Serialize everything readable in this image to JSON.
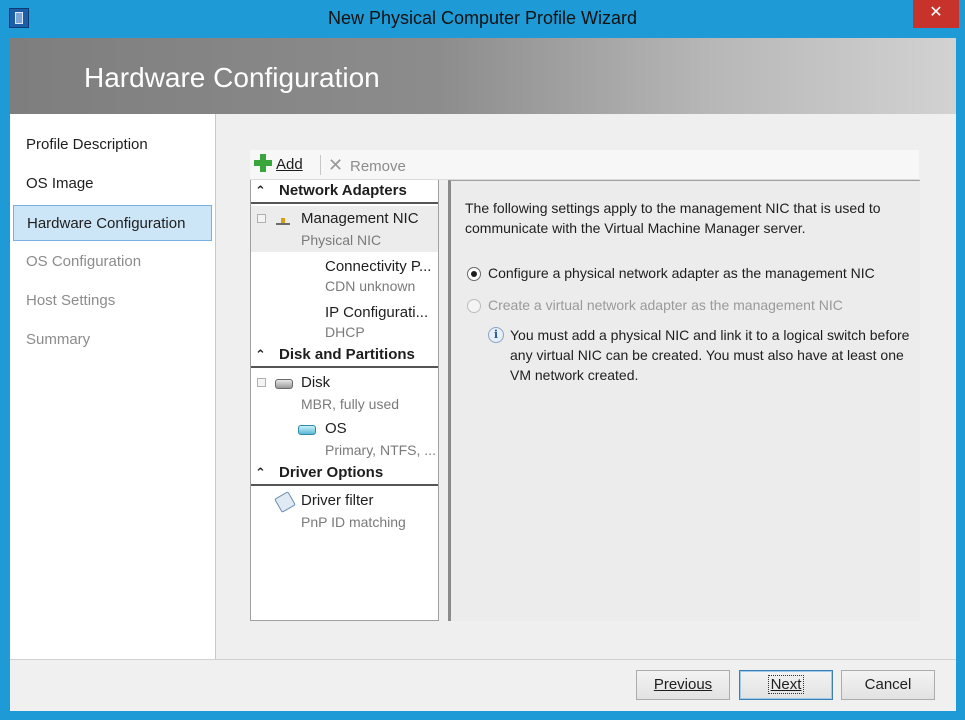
{
  "window": {
    "title": "New Physical Computer Profile Wizard",
    "close_label": "✕"
  },
  "banner": {
    "title": "Hardware Configuration"
  },
  "nav": {
    "items": [
      {
        "label": "Profile Description",
        "state": "normal"
      },
      {
        "label": "OS Image",
        "state": "normal"
      },
      {
        "label": "Hardware Configuration",
        "state": "active"
      },
      {
        "label": "OS Configuration",
        "state": "disabled"
      },
      {
        "label": "Host Settings",
        "state": "disabled"
      },
      {
        "label": "Summary",
        "state": "disabled"
      }
    ]
  },
  "toolbar": {
    "add_label": "Add",
    "remove_label": "Remove"
  },
  "tree": {
    "network_adapters": {
      "header": "Network Adapters",
      "nic": {
        "name": "Management NIC",
        "sub": "Physical NIC"
      },
      "connectivity": {
        "name": "Connectivity P...",
        "sub": "CDN unknown"
      },
      "ip": {
        "name": "IP Configurati...",
        "sub": "DHCP"
      }
    },
    "disk_partitions": {
      "header": "Disk and Partitions",
      "disk": {
        "name": "Disk",
        "sub": "MBR, fully used"
      },
      "os": {
        "name": "OS",
        "sub": "Primary, NTFS, ..."
      }
    },
    "driver_options": {
      "header": "Driver Options",
      "filter": {
        "name": "Driver filter",
        "sub": "PnP ID matching"
      }
    }
  },
  "detail": {
    "intro": "The following settings apply to the management NIC that is used to communicate with the Virtual Machine Manager server.",
    "option_physical": "Configure a physical network adapter as the management NIC",
    "option_virtual": "Create a virtual network adapter as the management NIC",
    "info": "You must add a physical NIC and link it to a logical switch before any virtual NIC can be created. You must also have at least one VM network created."
  },
  "footer": {
    "previous": "Previous",
    "next": "Next",
    "cancel": "Cancel"
  }
}
